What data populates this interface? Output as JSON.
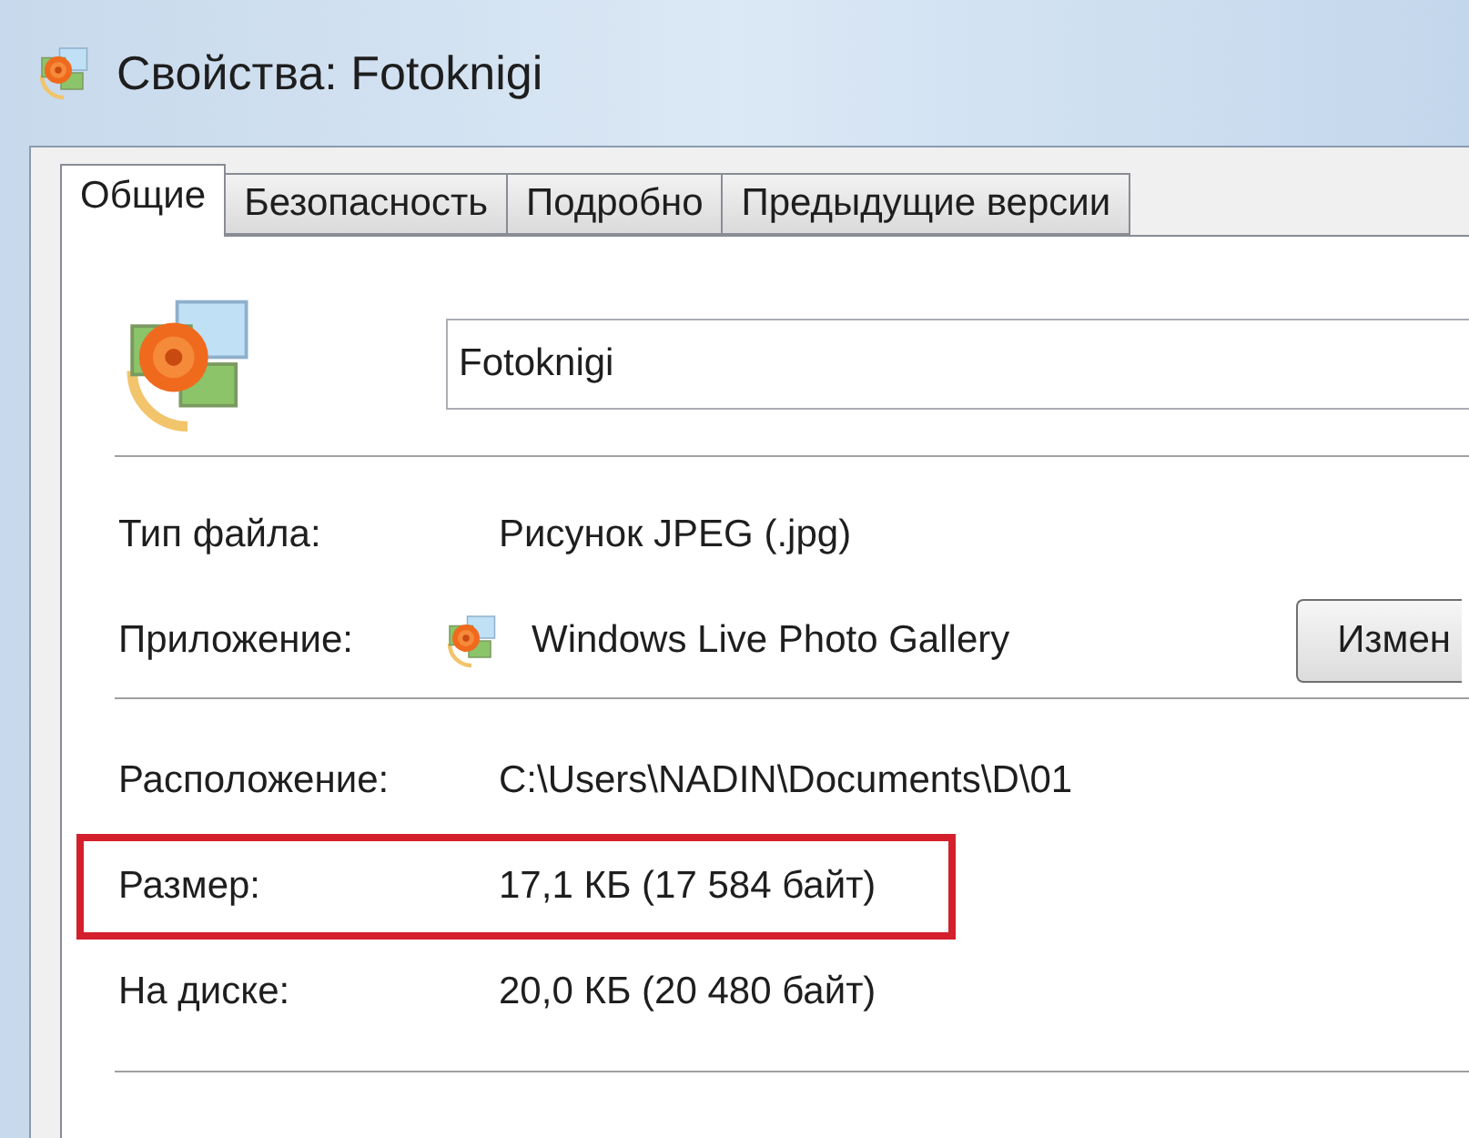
{
  "window": {
    "title": "Свойства: Fotoknigi"
  },
  "tabs": [
    {
      "label": "Общие",
      "selected": true
    },
    {
      "label": "Безопасность",
      "selected": false
    },
    {
      "label": "Подробно",
      "selected": false
    },
    {
      "label": "Предыдущие версии",
      "selected": false
    }
  ],
  "file_name": {
    "value": "Fotoknigi"
  },
  "type_rows": [
    {
      "kind": "text",
      "label": "Тип файла:",
      "value": "Рисунок JPEG (.jpg)",
      "highlighted": false
    },
    {
      "kind": "app",
      "label": "Приложение:",
      "value": "Windows Live Photo Gallery",
      "button": "Измен",
      "highlighted": false
    }
  ],
  "location_rows": [
    {
      "kind": "text",
      "label": "Расположение:",
      "value": "C:\\Users\\NADIN\\Documents\\D\\01",
      "highlighted": false
    },
    {
      "kind": "text",
      "label": "Размер:",
      "value": "17,1 КБ (17 584 байт)",
      "highlighted": true
    },
    {
      "kind": "text",
      "label": "На диске:",
      "value": "20,0 КБ (20 480 байт)",
      "highlighted": false
    }
  ]
}
